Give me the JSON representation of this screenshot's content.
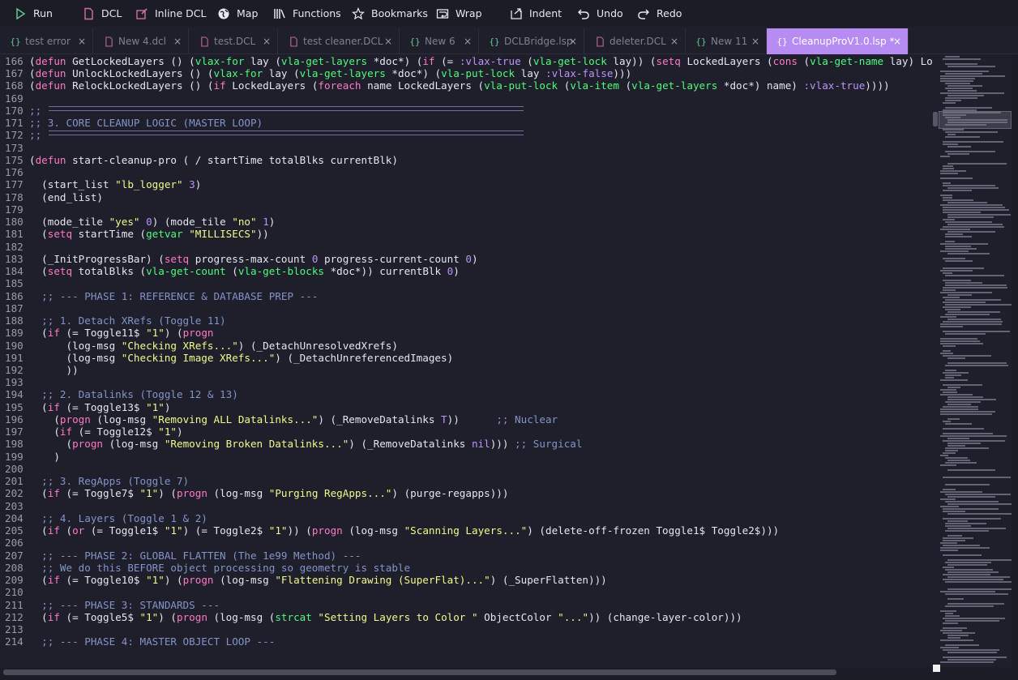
{
  "toolbar": {
    "items": [
      {
        "label": "Run",
        "icon": "run-icon"
      },
      {
        "label": "DCL",
        "icon": "file-icon"
      },
      {
        "label": "Inline DCL",
        "icon": "inline-edit-icon"
      },
      {
        "label": "Map",
        "icon": "globe-icon"
      },
      {
        "label": "Functions",
        "icon": "library-icon"
      },
      {
        "label": "Bookmarks",
        "icon": "star-icon"
      },
      {
        "label": "Wrap",
        "icon": "wrap-icon"
      },
      {
        "label": "Indent",
        "icon": "indent-icon"
      },
      {
        "label": "Undo",
        "icon": "undo-icon"
      },
      {
        "label": "Redo",
        "icon": "redo-icon"
      }
    ]
  },
  "tabs": [
    {
      "label": "test error",
      "icon": "{}",
      "kind": "code"
    },
    {
      "label": "New 4.dcl",
      "icon": "doc",
      "kind": "doc"
    },
    {
      "label": "test.DCL",
      "icon": "doc",
      "kind": "doc"
    },
    {
      "label": "test cleaner.DCL",
      "icon": "doc",
      "kind": "doc"
    },
    {
      "label": "New 6",
      "icon": "{}",
      "kind": "code"
    },
    {
      "label": "DCLBridge.lsp",
      "icon": "{}",
      "kind": "code"
    },
    {
      "label": "deleter.DCL",
      "icon": "doc",
      "kind": "doc"
    },
    {
      "label": "New 11",
      "icon": "{}",
      "kind": "code"
    },
    {
      "label": "CleanupProV1.0.lsp *",
      "icon": "{}",
      "kind": "code",
      "active": true
    }
  ],
  "close_glyph": "×",
  "colors": {
    "keyword": "#ff79c6",
    "function": "#50fa7b",
    "string": "#f1fa8c",
    "number": "#bd93f9",
    "comment": "#6272a4",
    "accent_tab": "#b68cf2",
    "background": "#1e1f2b"
  },
  "editor": {
    "lines": [
      {
        "n": "166",
        "code": "(defun GetLockedLayers () (vlax-for lay (vla-get-layers *doc*) (if (= :vlax-true (vla-get-lock lay)) (setq LockedLayers (cons (vla-get-name lay) Lo"
      },
      {
        "n": "167",
        "code": "(defun UnlockLockedLayers () (vlax-for lay (vla-get-layers *doc*) (vla-put-lock lay :vlax-false)))"
      },
      {
        "n": "168",
        "code": "(defun RelockLockedLayers () (if LockedLayers (foreach name LockedLayers (vla-put-lock (vla-item (vla-get-layers *doc*) name) :vlax-true))))"
      },
      {
        "n": "169",
        "code": ""
      },
      {
        "n": "170",
        "code": ";; "
      },
      {
        "n": "171",
        "code": ";; 3. CORE CLEANUP LOGIC (MASTER LOOP)"
      },
      {
        "n": "172",
        "code": ";; "
      },
      {
        "n": "173",
        "code": ""
      },
      {
        "n": "175",
        "code": "(defun start-cleanup-pro ( / startTime totalBlks currentBlk)"
      },
      {
        "n": "176",
        "code": ""
      },
      {
        "n": "177",
        "code": "  (start_list \"lb_logger\" 3)"
      },
      {
        "n": "178",
        "code": "  (end_list)"
      },
      {
        "n": "179",
        "code": ""
      },
      {
        "n": "180",
        "code": "  (mode_tile \"yes\" 0) (mode_tile \"no\" 1)"
      },
      {
        "n": "181",
        "code": "  (setq startTime (getvar \"MILLISECS\"))"
      },
      {
        "n": "182",
        "code": ""
      },
      {
        "n": "183",
        "code": "  (_InitProgressBar) (setq progress-max-count 0 progress-current-count 0)"
      },
      {
        "n": "184",
        "code": "  (setq totalBlks (vla-get-count (vla-get-blocks *doc*)) currentBlk 0)"
      },
      {
        "n": "185",
        "code": ""
      },
      {
        "n": "186",
        "code": "  ;; --- PHASE 1: REFERENCE & DATABASE PREP ---"
      },
      {
        "n": "187",
        "code": ""
      },
      {
        "n": "188",
        "code": "  ;; 1. Detach XRefs (Toggle 11)"
      },
      {
        "n": "189",
        "code": "  (if (= Toggle11$ \"1\") (progn"
      },
      {
        "n": "190",
        "code": "      (log-msg \"Checking XRefs...\") (_DetachUnresolvedXrefs)"
      },
      {
        "n": "191",
        "code": "      (log-msg \"Checking Image XRefs...\") (_DetachUnreferencedImages)"
      },
      {
        "n": "192",
        "code": "      ))"
      },
      {
        "n": "193",
        "code": ""
      },
      {
        "n": "194",
        "code": "  ;; 2. Datalinks (Toggle 12 & 13)"
      },
      {
        "n": "195",
        "code": "  (if (= Toggle13$ \"1\")"
      },
      {
        "n": "196",
        "code": "    (progn (log-msg \"Removing ALL Datalinks...\") (_RemoveDatalinks T))      ;; Nuclear"
      },
      {
        "n": "197",
        "code": "    (if (= Toggle12$ \"1\")"
      },
      {
        "n": "198",
        "code": "      (progn (log-msg \"Removing Broken Datalinks...\") (_RemoveDatalinks nil))) ;; Surgical"
      },
      {
        "n": "199",
        "code": "    )"
      },
      {
        "n": "200",
        "code": ""
      },
      {
        "n": "201",
        "code": "  ;; 3. RegApps (Toggle 7)"
      },
      {
        "n": "202",
        "code": "  (if (= Toggle7$ \"1\") (progn (log-msg \"Purging RegApps...\") (purge-regapps)))"
      },
      {
        "n": "203",
        "code": ""
      },
      {
        "n": "204",
        "code": "  ;; 4. Layers (Toggle 1 & 2)"
      },
      {
        "n": "205",
        "code": "  (if (or (= Toggle1$ \"1\") (= Toggle2$ \"1\")) (progn (log-msg \"Scanning Layers...\") (delete-off-frozen Toggle1$ Toggle2$)))"
      },
      {
        "n": "206",
        "code": ""
      },
      {
        "n": "207",
        "code": "  ;; --- PHASE 2: GLOBAL FLATTEN (The 1e99 Method) ---"
      },
      {
        "n": "208",
        "code": "  ;; We do this BEFORE object processing so geometry is stable"
      },
      {
        "n": "209",
        "code": "  (if (= Toggle10$ \"1\") (progn (log-msg \"Flattening Drawing (SuperFlat)...\") (_SuperFlatten)))"
      },
      {
        "n": "210",
        "code": ""
      },
      {
        "n": "211",
        "code": "  ;; --- PHASE 3: STANDARDS ---"
      },
      {
        "n": "212",
        "code": "  (if (= Toggle5$ \"1\") (progn (log-msg (strcat \"Setting Layers to Color \" ObjectColor \"...\")) (change-layer-color)))"
      },
      {
        "n": "213",
        "code": ""
      },
      {
        "n": "214",
        "code": "  ;; --- PHASE 4: MASTER OBJECT LOOP ---"
      }
    ]
  }
}
